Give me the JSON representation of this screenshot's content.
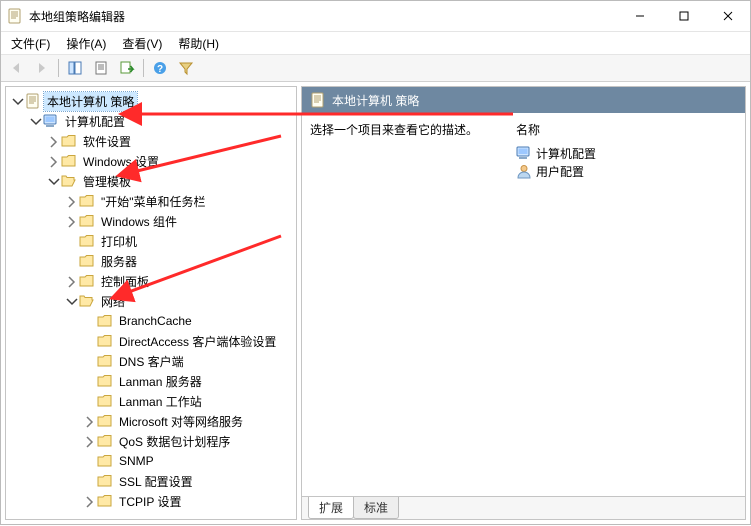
{
  "window": {
    "title": "本地组策略编辑器"
  },
  "menu": {
    "file": "文件(F)",
    "action": "操作(A)",
    "view": "查看(V)",
    "help": "帮助(H)"
  },
  "tree": {
    "root": "本地计算机 策略",
    "computer_config": "计算机配置",
    "software_settings": "软件设置",
    "windows_settings": "Windows 设置",
    "admin_templates": "管理模板",
    "start_menu_taskbar": "\"开始\"菜单和任务栏",
    "windows_components": "Windows 组件",
    "printers": "打印机",
    "servers": "服务器",
    "control_panel": "控制面板",
    "network": "网络",
    "branchcache": "BranchCache",
    "directaccess": "DirectAccess 客户端体验设置",
    "dns_client": "DNS 客户端",
    "lanman_server": "Lanman 服务器",
    "lanman_workstation": "Lanman 工作站",
    "ms_p2p": "Microsoft 对等网络服务",
    "qos": "QoS 数据包计划程序",
    "snmp": "SNMP",
    "ssl_config": "SSL 配置设置",
    "tcpip": "TCPIP 设置"
  },
  "details": {
    "header": "本地计算机 策略",
    "hint": "选择一个项目来查看它的描述。",
    "col_name": "名称",
    "items": [
      {
        "label": "计算机配置",
        "icon": "computer"
      },
      {
        "label": "用户配置",
        "icon": "user"
      }
    ]
  },
  "tabs": {
    "extended": "扩展",
    "standard": "标准"
  }
}
